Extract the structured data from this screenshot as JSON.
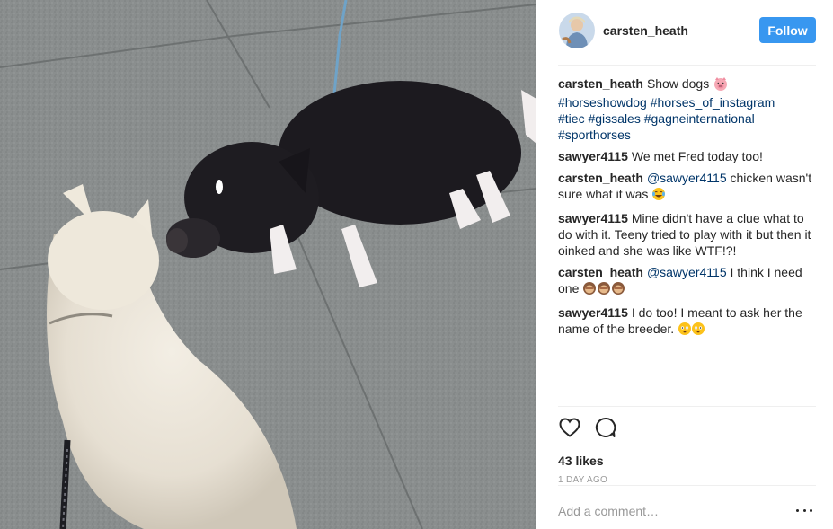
{
  "post": {
    "username": "carsten_heath",
    "follow_label": "Follow",
    "caption": {
      "author": "carsten_heath",
      "text": "Show dogs",
      "emoji": "pig-face",
      "hashtags": [
        "#horseshowdog",
        "#horses_of_instagram",
        "#tiec",
        "#gissales",
        "#gagneinternational",
        "#sporthorses"
      ]
    },
    "comments": [
      {
        "author": "sawyer4115",
        "mention": "",
        "text": "We met Fred today too!",
        "emoji": ""
      },
      {
        "author": "carsten_heath",
        "mention": "@sawyer4115",
        "text": "chicken wasn't sure what it was",
        "emoji": "tears-of-joy"
      },
      {
        "author": "sawyer4115",
        "mention": "",
        "text": "Mine didn't have a clue what to do with it. Teeny tried to play with it but then it oinked and she was like WTF!?!",
        "emoji": ""
      },
      {
        "author": "carsten_heath",
        "mention": "@sawyer4115",
        "text": "I think I need one",
        "emoji": "see-no-evil-monkeys"
      },
      {
        "author": "sawyer4115",
        "mention": "",
        "text": "I do too! I meant to ask her the name of the breeder.",
        "emoji": "flushed-faces"
      }
    ],
    "likes": "43 likes",
    "time": "1 DAY AGO",
    "comment_placeholder": "Add a comment…",
    "accent_color": "#3897f0",
    "hashtag_color": "#003569"
  }
}
